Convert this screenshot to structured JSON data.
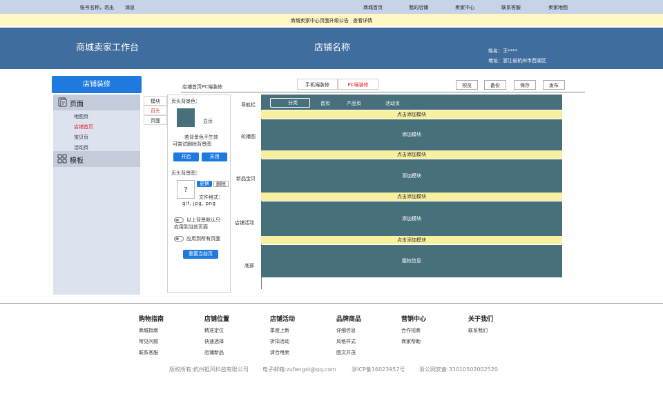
{
  "topbar": {
    "account": "账号名称，退出",
    "messages": "消息",
    "links": [
      "商城首页",
      "我的店铺",
      "卖家中心",
      "联系客服",
      "卖家地图"
    ]
  },
  "notice": {
    "text": "商城卖家中心页面升级公告",
    "link": "查看详情"
  },
  "banner": {
    "workbench": "商城卖家工作台",
    "shop_name": "店铺名称",
    "name_line": "姓名：王****",
    "address_line": "地址：浙江省杭州市西湖区"
  },
  "sidebar": {
    "main_button": "店铺装修",
    "pages_heading": "页面",
    "pages_icon": "document-icon",
    "pages": [
      "地图页",
      "店铺首页",
      "宝贝页",
      "活动页"
    ],
    "active_page": "店铺首页",
    "templates_heading": "模板",
    "templates_icon": "grid-icon"
  },
  "module_tabs": [
    "模块",
    "页头",
    "页面"
  ],
  "active_module_tab": "页头",
  "settings": {
    "bg_color_label": "页头背景色：",
    "show_label": "显示",
    "hint_line1": "若背景色不生效",
    "hint_line2": "可尝试删除背景图",
    "enable": "开启",
    "close": "关闭",
    "bg_image_label": "页头背景图：",
    "image_placeholder": "?",
    "replace": "更换",
    "delete": "删除",
    "format_label": "文件格式：",
    "formats": "gif, jpg, png",
    "apply_current_1": "以上背景默认只",
    "apply_current_2": "应用到当前页面",
    "apply_all": "应用到所有页面",
    "reset": "重置当前页",
    "accent": "#1f7ae0",
    "swatch_color": "#476f7c"
  },
  "editor": {
    "title": "店铺首页PC端装修",
    "mobile_tab": "手机端装修",
    "pc_tab": "PC端装修",
    "actions": [
      "预览",
      "备份",
      "保存",
      "发布"
    ]
  },
  "canvas": {
    "row_labels": [
      "导航栏",
      "轮播图",
      "新品宝贝",
      "店铺活动",
      "底部"
    ],
    "nav_category": "分类",
    "nav_items": [
      "首页",
      "产品页",
      "活动页"
    ],
    "add_prompt": "点击添加模块",
    "add_module": "添加模块",
    "footer_block": "版权信息",
    "block_color": "#476f7c",
    "add_bar_color": "#f8f0a0"
  },
  "footer": {
    "columns": [
      {
        "title": "购物指南",
        "items": [
          "商城指南",
          "常见问题",
          "联系客服"
        ]
      },
      {
        "title": "店铺位置",
        "items": [
          "精准定位",
          "快速选择",
          "店铺新品"
        ]
      },
      {
        "title": "店铺活动",
        "items": [
          "季度上新",
          "折扣活动",
          "清仓甩卖"
        ]
      },
      {
        "title": "品牌商品",
        "items": [
          "详细信息",
          "风格样式",
          "图文并茂"
        ]
      },
      {
        "title": "营销中心",
        "items": [
          "合作招商",
          "商家帮助"
        ]
      },
      {
        "title": "关于我们",
        "items": [
          "联系我们"
        ]
      }
    ],
    "copyright": "版权所有:杭州祖风科技有限公司",
    "email": "电子邮箱:zufengst@qq.com",
    "icp": "浙ICP备16023957号",
    "police": "浙公网安备:33010502002520"
  }
}
